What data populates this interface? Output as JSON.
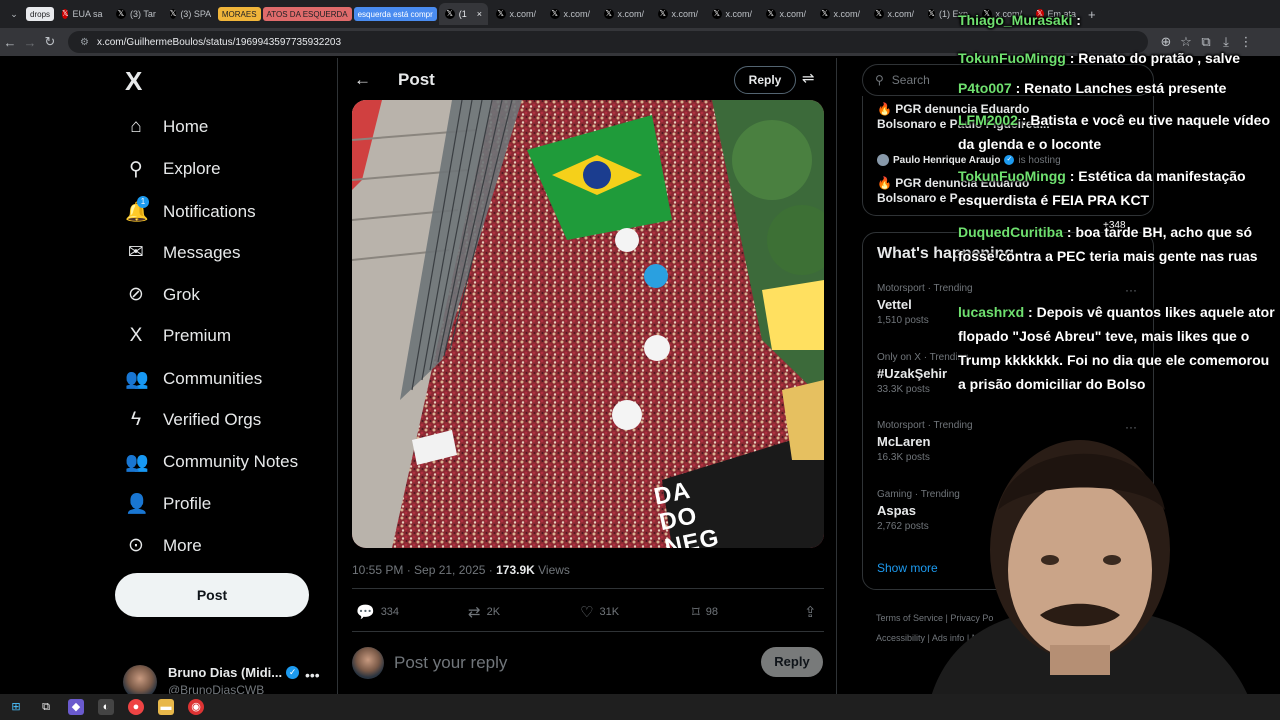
{
  "browser": {
    "tabs": [
      {
        "label": "drops",
        "kind": "pill",
        "color": "#e8eaed",
        "text_color": "#202124"
      },
      {
        "label": "EUA sa",
        "kind": "tab",
        "icon_color": "#cc0000"
      },
      {
        "label": "(3) Tar",
        "kind": "tab",
        "icon_color": "#000000"
      },
      {
        "label": "(3) SPA",
        "kind": "tab",
        "icon_color": "#000000"
      },
      {
        "label": "MORAES",
        "kind": "pill",
        "color": "#f0b53a",
        "text_color": "#202124"
      },
      {
        "label": "ATOS DA ESQUERDA",
        "kind": "pill",
        "color": "#e06b6b",
        "text_color": "#202124"
      },
      {
        "label": "esquerda está compr",
        "kind": "pill",
        "color": "#4a8cf0",
        "text_color": "#ffffff"
      },
      {
        "label": "(1",
        "kind": "active"
      },
      {
        "label": "x.com/",
        "kind": "tab",
        "icon_color": "#000000"
      },
      {
        "label": "x.com/",
        "kind": "tab",
        "icon_color": "#000000"
      },
      {
        "label": "x.com/",
        "kind": "tab",
        "icon_color": "#000000"
      },
      {
        "label": "x.com/",
        "kind": "tab",
        "icon_color": "#000000"
      },
      {
        "label": "x.com/",
        "kind": "tab",
        "icon_color": "#000000"
      },
      {
        "label": "x.com/",
        "kind": "tab",
        "icon_color": "#000000"
      },
      {
        "label": "x.com/",
        "kind": "tab",
        "icon_color": "#000000"
      },
      {
        "label": "x.com/",
        "kind": "tab",
        "icon_color": "#000000"
      },
      {
        "label": "(1) Exp",
        "kind": "tab",
        "icon_color": "#000000"
      },
      {
        "label": "x.com/",
        "kind": "tab",
        "icon_color": "#000000"
      },
      {
        "label": "Em ata",
        "kind": "tab",
        "icon_color": "#cc0000"
      }
    ],
    "url": "x.com/GuilhermeBoulos/status/1969943597735932203"
  },
  "nav": {
    "logo": "X",
    "items": [
      {
        "label": "Home",
        "glyph": "⌂",
        "icon": "home-icon"
      },
      {
        "label": "Explore",
        "glyph": "⚲",
        "icon": "search-icon"
      },
      {
        "label": "Notifications",
        "glyph": "🔔",
        "icon": "bell-icon",
        "badge": "1"
      },
      {
        "label": "Messages",
        "glyph": "✉",
        "icon": "mail-icon"
      },
      {
        "label": "Grok",
        "glyph": "⊘",
        "icon": "grok-icon"
      },
      {
        "label": "Premium",
        "glyph": "X",
        "icon": "x-premium-icon"
      },
      {
        "label": "Communities",
        "glyph": "👥",
        "icon": "communities-icon"
      },
      {
        "label": "Verified Orgs",
        "glyph": "ϟ",
        "icon": "lightning-icon"
      },
      {
        "label": "Community Notes",
        "glyph": "👥",
        "icon": "community-notes-icon"
      },
      {
        "label": "Profile",
        "glyph": "👤",
        "icon": "person-icon"
      },
      {
        "label": "More",
        "glyph": "⊙",
        "icon": "more-circle-icon"
      }
    ],
    "post_button": "Post",
    "account": {
      "name": "Bruno Dias (Midi...",
      "handle": "@BrunoDiasCWB"
    }
  },
  "main": {
    "header_title": "Post",
    "reply_button": "Reply",
    "timestamp": "10:55 PM · Sep 21, 2025 · ",
    "views_count": "173.9K",
    "views_label": " Views",
    "banner_text": "DA DO NEGRO",
    "actions": {
      "replies": "334",
      "reposts": "2K",
      "likes": "31K",
      "bookmarks": "98"
    },
    "reply_placeholder": "Post your reply",
    "reply_submit": "Reply"
  },
  "sidebar": {
    "search_placeholder": "Search",
    "live": [
      {
        "title": "🔥 PGR denuncia Eduardo Bolsonaro e Paulo Figueired..."
      },
      {
        "host_name": "Paulo Henrique Araujo",
        "host_suffix": "is hosting",
        "title": "🔥 PGR denuncia Eduardo Bolsonaro e P",
        "listeners": "+348"
      }
    ],
    "happening_title": "What's happening",
    "trends": [
      {
        "meta": "Motorsport · Trending",
        "name": "Vettel",
        "count": "1,510 posts"
      },
      {
        "meta": "Only on X · Trending",
        "name": "#UzakŞehir",
        "count": "33.3K posts"
      },
      {
        "meta": "Motorsport · Trending",
        "name": "McLaren",
        "count": "16.3K posts"
      },
      {
        "meta": "Gaming · Trending",
        "name": "Aspas",
        "count": "2,762 posts"
      }
    ],
    "show_more": "Show more",
    "footer": [
      "Terms of Service",
      "Privacy Po",
      "Accessibility",
      "Ads info",
      "Mo"
    ]
  },
  "chat": [
    {
      "user": "Thiago_Murasaki",
      "text": " :"
    },
    {
      "user": "TokunFuoMingg",
      "text": " : Renato do pratão , salve"
    },
    {
      "user": "P4to007",
      "text": " : Renato Lanches está presente"
    },
    {
      "user": "LFM2002",
      "text": " : Batista e você eu tive naquele vídeo da glenda e o loconte"
    },
    {
      "user": "TokunFuoMingg",
      "text": " : Estética da manifestação esquerdista é FEIA PRA KCT"
    },
    {
      "user": "DuquedCuritiba",
      "text": " : boa tarde BH, acho que só fosse contra a PEC teria mais gente nas ruas"
    },
    {
      "user": "lucashrxd",
      "text": " : Depois vê quantos likes aquele ator flopado \"José Abreu\" teve, mais likes que o Trump kkkkkkk. Foi no dia que ele comemorou a prisão domiciliar do Bolso"
    }
  ],
  "colors": {
    "x_blue": "#1d9bf0",
    "chat_user": "#6fe06f",
    "bg": "#000000"
  }
}
